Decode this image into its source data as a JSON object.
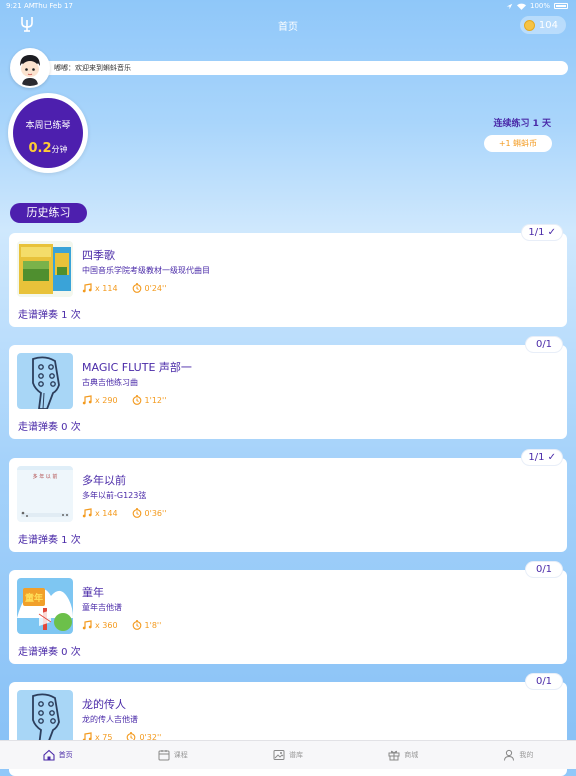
{
  "status_bar": {
    "time": "9:21 AM",
    "date": "Thu Feb 17",
    "battery": "100%"
  },
  "nav": {
    "title": "首页",
    "coins": "104"
  },
  "greeting": "嘟嘟：欢迎来到蝌蚪音乐",
  "weekly": {
    "label": "本周已练琴",
    "value": "0.2",
    "unit": "分钟"
  },
  "streak": {
    "text": "连续练习 1 天",
    "reward": "+1 蝌蚪币"
  },
  "history_label": "历史练习",
  "cards": [
    {
      "title": "四季歌",
      "subtitle": "中国音乐学院考级教材一级现代曲目",
      "notes": "x 114",
      "duration": "0'24''",
      "plays": "走谱弹奏 1 次",
      "badge": "1/1 ✓",
      "thumb": "book-cover"
    },
    {
      "title": "MAGIC FLUTE 声部一",
      "subtitle": "古典吉他练习曲",
      "notes": "x 290",
      "duration": "1'12''",
      "plays": "走谱弹奏 0 次",
      "badge": "0/1",
      "thumb": "guitar-headstock"
    },
    {
      "title": "多年以前",
      "subtitle": "多年以前-G123弦",
      "notes": "x 144",
      "duration": "0'36''",
      "plays": "走谱弹奏 1 次",
      "badge": "1/1 ✓",
      "thumb": "sheet-music",
      "thumb_text": "多 年 以 前"
    },
    {
      "title": "童年",
      "subtitle": "童年吉他谱",
      "notes": "x 360",
      "duration": "1'8''",
      "plays": "走谱弹奏 0 次",
      "badge": "0/1",
      "thumb": "childhood-cover",
      "thumb_text": "童年"
    },
    {
      "title": "龙的传人",
      "subtitle": "龙的传人吉他谱",
      "notes": "x 75",
      "duration": "0'32''",
      "plays": "",
      "badge": "0/1",
      "thumb": "guitar-headstock"
    }
  ],
  "tabs": [
    {
      "label": "首页",
      "icon": "home-icon",
      "active": true
    },
    {
      "label": "课程",
      "icon": "calendar-icon",
      "active": false
    },
    {
      "label": "谱库",
      "icon": "image-library-icon",
      "active": false
    },
    {
      "label": "商城",
      "icon": "gift-icon",
      "active": false
    },
    {
      "label": "我的",
      "icon": "user-icon",
      "active": false
    }
  ],
  "colors": {
    "accent": "#4d1fae",
    "highlight": "#f39a1e",
    "gold": "#ffcc33"
  }
}
